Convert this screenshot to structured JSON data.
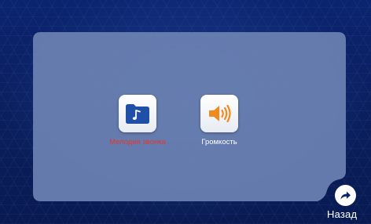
{
  "menu": {
    "items": [
      {
        "label": "Мелодия звонка",
        "icon": "music-folder-icon",
        "label_color": "#e0382e",
        "selected": true
      },
      {
        "label": "Громкость",
        "icon": "speaker-volume-icon",
        "label_color": "#ffffff",
        "selected": false
      }
    ]
  },
  "footer": {
    "back_label": "Назад",
    "back_icon": "return-arrow-icon"
  },
  "colors": {
    "background": "#0a1f5e",
    "panel": "#6a7fb0",
    "folder_icon": "#1f4fa6",
    "speaker_icon": "#f08a1e",
    "selected_label": "#e0382e"
  }
}
